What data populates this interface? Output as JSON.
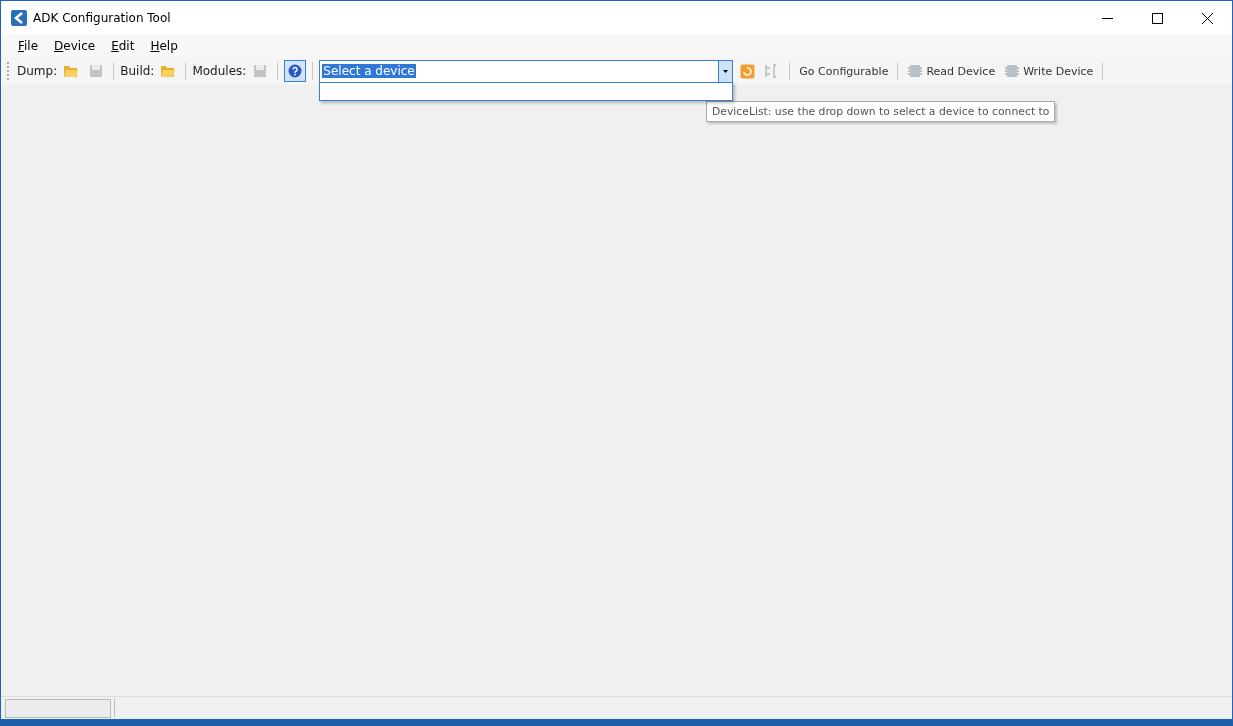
{
  "window": {
    "title": "ADK Configuration Tool"
  },
  "menu": [
    "File",
    "Device",
    "Edit",
    "Help"
  ],
  "toolbar": [
    {
      "kind": "label",
      "text": "Dump:"
    },
    {
      "kind": "open",
      "disabled": false
    },
    {
      "kind": "save",
      "disabled": true
    },
    {
      "kind": "separator"
    },
    {
      "kind": "label",
      "text": "Build:"
    },
    {
      "kind": "open",
      "disabled": false
    },
    {
      "kind": "separator"
    },
    {
      "kind": "label",
      "text": "Modules:"
    },
    {
      "kind": "save",
      "disabled": true
    },
    {
      "kind": "separator"
    },
    {
      "kind": "help",
      "disabled": false,
      "pressed": true
    },
    {
      "kind": "separator"
    },
    {
      "kind": "combo",
      "value": "Select a device",
      "expanded": true
    },
    {
      "kind": "refresh",
      "disabled": false
    },
    {
      "kind": "bracket",
      "disabled": true
    },
    {
      "kind": "separator"
    },
    {
      "kind": "button",
      "text": "Go Configurable"
    },
    {
      "kind": "separator"
    },
    {
      "kind": "chipbutton",
      "text": "Read Device"
    },
    {
      "kind": "chipbutton",
      "text": "Write Device"
    },
    {
      "kind": "separator"
    }
  ],
  "tooltip": "DeviceList: use the drop down to select a device to connect to"
}
